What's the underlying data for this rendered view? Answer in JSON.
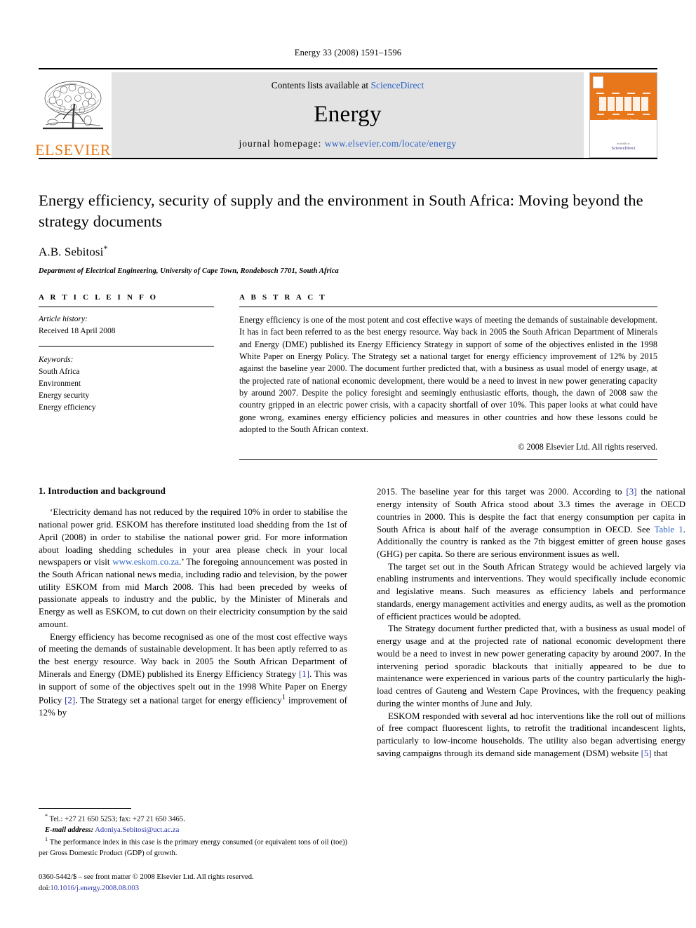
{
  "running_head": "Energy 33 (2008) 1591–1596",
  "masthead": {
    "contents_prefix": "Contents lists available at ",
    "contents_link": "ScienceDirect",
    "journal_name": "Energy",
    "homepage_label": "journal homepage: ",
    "homepage_url": "www.elsevier.com/locate/energy",
    "publisher_wordmark": "ELSEVIER",
    "cover_tagline": "An International Journal",
    "cover_publisher": "available at",
    "cover_publisher_name": "ScienceDirect"
  },
  "article": {
    "title": "Energy efficiency, security of supply and the environment in South Africa: Moving beyond the strategy documents",
    "author": "A.B. Sebitosi",
    "author_marker": "*",
    "affiliation": "Department of Electrical Engineering, University of Cape Town, Rondebosch 7701, South Africa"
  },
  "info": {
    "heading": "A R T I C L E   I N F O",
    "history_label": "Article history:",
    "history_value": "Received 18 April 2008",
    "keywords_label": "Keywords:",
    "keywords": [
      "South Africa",
      "Environment",
      "Energy security",
      "Energy efficiency"
    ]
  },
  "abstract": {
    "heading": "A B S T R A C T",
    "text": "Energy efficiency is one of the most potent and cost effective ways of meeting the demands of sustainable development. It has in fact been referred to as the best energy resource. Way back in 2005 the South African Department of Minerals and Energy (DME) published its Energy Efficiency Strategy in support of some of the objectives enlisted in the 1998 White Paper on Energy Policy. The Strategy set a national target for energy efficiency improvement of 12% by 2015 against the baseline year 2000. The document further predicted that, with a business as usual model of energy usage, at the projected rate of national economic development, there would be a need to invest in new power generating capacity by around 2007. Despite the policy foresight and seemingly enthusiastic efforts, though, the dawn of 2008 saw the country gripped in an electric power crisis, with a capacity shortfall of over 10%. This paper looks at what could have gone wrong, examines energy efficiency policies and measures in other countries and how these lessons could be adopted to the South African context.",
    "copyright": "© 2008 Elsevier Ltd. All rights reserved."
  },
  "body": {
    "section_title": "1.  Introduction and background",
    "left": {
      "p1_a": "‘Electricity demand has not reduced by the required 10% in order to stabilise the national power grid. ESKOM has therefore instituted load shedding from the 1st of April (2008) in order to stabilise the national power grid. For more information about loading shedding schedules in your area please check in your local newspapers or visit ",
      "p1_link": "www.eskom.co.za",
      "p1_b": ".’ The foregoing announcement was posted in the South African national news media, including radio and television, by the power utility ESKOM from mid March 2008. This had been preceded by weeks of passionate appeals to industry and the public, by the Minister of Minerals and Energy as well as ESKOM, to cut down on their electricity consumption by the said amount.",
      "p2_a": "Energy efficiency has become recognised as one of the most cost effective ways of meeting the demands of sustainable development. It has been aptly referred to as the best energy resource. Way back in 2005 the South African Department of Minerals and Energy (DME) published its Energy Efficiency Strategy ",
      "p2_ref1": "[1]",
      "p2_b": ". This was in support of some of the objectives spelt out in the 1998 White Paper on Energy Policy ",
      "p2_ref2": "[2]",
      "p2_c": ". The Strategy set a national target for energy efficiency",
      "p2_sup": "1",
      "p2_d": " improvement of 12% by"
    },
    "right": {
      "p1_a": "2015. The baseline year for this target was 2000. According to ",
      "p1_ref": "[3]",
      "p1_b": " the national energy intensity of South Africa stood about 3.3 times the average in OECD countries in 2000. This is despite the fact that energy consumption per capita in South Africa is about half of the average consumption in OECD. See ",
      "p1_link": "Table 1",
      "p1_c": ". Additionally the country is ranked as the 7th biggest emitter of green house gases (GHG) per capita. So there are serious environment issues as well.",
      "p2": "The target set out in the South African Strategy would be achieved largely via enabling instruments and interventions. They would specifically include economic and legislative means. Such measures as efficiency labels and performance standards, energy management activities and energy audits, as well as the promotion of efficient practices would be adopted.",
      "p3": "The Strategy document further predicted that, with a business as usual model of energy usage and at the projected rate of national economic development there would be a need to invest in new power generating capacity by around 2007. In the intervening period sporadic blackouts that initially appeared to be due to maintenance were experienced in various parts of the country particularly the high-load centres of Gauteng and Western Cape Provinces, with the frequency peaking during the winter months of June and July.",
      "p4_a": "ESKOM responded with several ad hoc interventions like the roll out of millions of free compact fluorescent lights, to retrofit the traditional incandescent lights, particularly to low-income households. The utility also began advertising energy saving campaigns through its demand side management (DSM) website ",
      "p4_ref": "[5]",
      "p4_b": " that"
    }
  },
  "footnotes": {
    "star_marker": "*",
    "star_text": " Tel.: +27 21 650 5253; fax: +27 21 650 3465.",
    "email_label": "E-mail address:",
    "email": "Adoniya.Sebitosi@uct.ac.za",
    "fn1_marker": "1",
    "fn1_text": " The performance index in this case is the primary energy consumed (or equivalent tons of oil (toe)) per Gross Domestic Product (GDP) of growth."
  },
  "imprint": {
    "line1": "0360-5442/$ – see front matter © 2008 Elsevier Ltd. All rights reserved.",
    "doi_label": "doi:",
    "doi": "10.1016/j.energy.2008.08.003"
  },
  "colors": {
    "elsevier_orange": "#E87B1E",
    "link_blue": "#2B62C6",
    "ref_blue": "#2B35A8",
    "band_gray": "#e3e3e3"
  }
}
